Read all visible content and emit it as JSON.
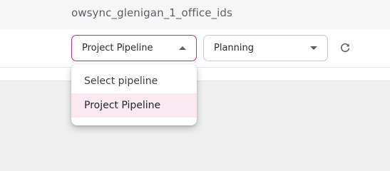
{
  "header": {
    "title": "owsync_glenigan_1_office_ids"
  },
  "filters": {
    "pipeline_select": {
      "value": "Project Pipeline",
      "open": true,
      "options": [
        "Select pipeline",
        "Project Pipeline"
      ],
      "selected_index": 1
    },
    "stage_select": {
      "value": "Planning"
    },
    "refresh_icon": "refresh-icon"
  },
  "colors": {
    "accent": "#c02c86",
    "selected_option_bg": "#fbe9f2"
  }
}
